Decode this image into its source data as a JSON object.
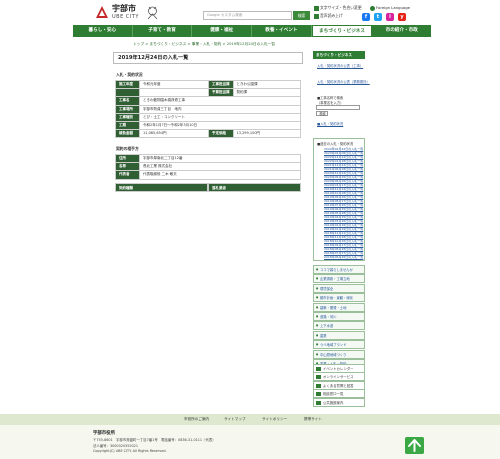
{
  "header": {
    "site_name": "宇部市",
    "site_name_en": "UBE CITY",
    "search_placeholder": "Google カスタム検索",
    "search_button": "検索",
    "text_size_label": "文字サイズ・色合い変更",
    "foreign_language_label": "Foreign Language",
    "voice_label": "音声読み上げ",
    "sns": [
      "f",
      "t",
      "i",
      "y"
    ]
  },
  "nav": {
    "items": [
      {
        "label": "暮らし・安心"
      },
      {
        "label": "子育て・教育"
      },
      {
        "label": "健康・福祉"
      },
      {
        "label": "教養・イベント"
      },
      {
        "label": "まちづくり・ビジネス"
      },
      {
        "label": "市の紹介・市政"
      }
    ],
    "active_index": 4
  },
  "breadcrumb": "トップ > まちづくり・ビジネス > 事業・入札・契約 > 2019年12月24日の入札一覧",
  "main": {
    "title": "2019年12月24日の入札一覧",
    "section1": "入札・契約状況",
    "rows": [
      {
        "k1": "施工年度",
        "v1": "令和元年度",
        "k2": "工事担当課",
        "v2": "ときわ公園課"
      },
      {
        "k1": "",
        "v1": "",
        "k2": "予算担当課",
        "v2": "契約課"
      },
      {
        "k1": "工事名",
        "v1": "ときわ動物園木橋改修工事",
        "k2": "",
        "v2": ""
      },
      {
        "k1": "工事場所",
        "v1": "宇部市則貞三丁目　地内",
        "k2": "",
        "v2": ""
      },
      {
        "k1": "工事種別",
        "v1": "とび・土工・コンクリート",
        "k2": "",
        "v2": ""
      },
      {
        "k1": "工期",
        "v1": "令和2年1月7日～令和2年3月10日",
        "k2": "",
        "v2": ""
      },
      {
        "k1": "請負金額",
        "v1": "11,065,654円",
        "k2": "予定価格",
        "v2": "13,299,100円"
      }
    ],
    "section2": "契約の相手方",
    "contractor_rows": [
      {
        "k": "住所",
        "v": "宇部市厚南北二丁目12番"
      },
      {
        "k": "名称",
        "v": "長北工業 株式会社"
      },
      {
        "k": "代表者",
        "v": "代表取締役 二木 敏夫"
      }
    ],
    "empty_headers": [
      "契約種類",
      "落札業者"
    ]
  },
  "sidebar": {
    "title": "まちづくり・ビジネス",
    "links": [
      "入札・契約状況の公表（工事）",
      "入札・契約状況の公表（業務委託）"
    ],
    "search_label": "■工事名称で検索",
    "search_hint": "（事業名を入力）",
    "search_value": "",
    "search_button": "検索",
    "back_label": "■入札・契約状況",
    "year_title": "■過去の入札・契約状況",
    "year_links": [
      "2024年02月22日の入札一覧",
      "2023年02月06日の入札一覧",
      "2022年12月22日の入札一覧",
      "2022年01月28日の入札一覧",
      "2021年12月24日の入札一覧",
      "2021年06月28日の入札一覧",
      "2020年12月24日の入札一覧",
      "2020年09月25日の入札一覧",
      "2020年06月26日の入札一覧",
      "2020年03月27日の入札一覧",
      "2019年12月24日の入札一覧",
      "2019年10月28日の入札一覧",
      "2019年09月26日の入札一覧",
      "2019年08月27日の入札一覧",
      "2019年07月26日の入札一覧",
      "2019年06月25日の入札一覧",
      "2019年05月28日の入札一覧",
      "2019年04月25日の入札一覧",
      "2019年03月26日の入札一覧",
      "2019年02月26日の入札一覧",
      "2019年01月29日の入札一覧",
      "2018年12月21日の入札一覧",
      "2018年11月28日の入札一覧",
      "2018年10月26日の入札一覧",
      "2018年09月27日の入札一覧",
      "2018年08月28日の入札一覧",
      "2018年07月27日の入札一覧",
      "2018年06月26日の入札一覧"
    ],
    "categories": [
      "ココで暮らしませんか",
      "企業誘致・工場立地",
      "環境保全",
      "都市計画・景観・緑化",
      "建築・開発・土地",
      "道路・河川",
      "上下水道",
      "農業",
      "うべ地域ブランド",
      "中山間地域づくり",
      "事業・入札・契約"
    ],
    "utilities": [
      "イベントカレンダー",
      "オンラインサービス",
      "よくある質問と回答",
      "相談窓口一覧",
      "公共施設案内"
    ]
  },
  "footer": {
    "links": [
      "市役所のご案内",
      "サイトマップ",
      "サイトポリシー",
      "携帯サイト"
    ],
    "name": "宇部市役所",
    "address": "〒755-8601　宇部市常盤町一丁目7番1号　電話番号：0836-31-0111（代表）",
    "corporate_number": "法人番号：3000020352021",
    "copyright": "Copyright(C) UBE CITY. All Rights Reserved."
  },
  "colors": {
    "brand_green": "#2e7d32",
    "table_header": "#2f5f33",
    "link_blue": "#2a5a9a",
    "to_top_green": "#39a845"
  }
}
